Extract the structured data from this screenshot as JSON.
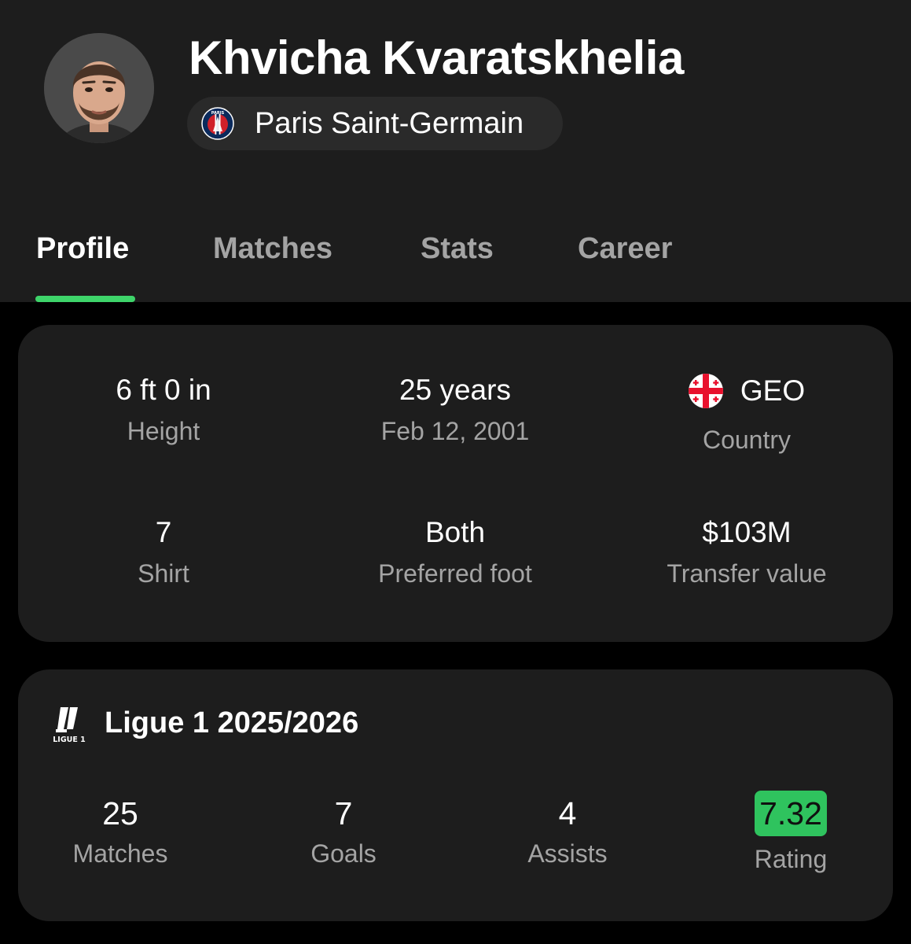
{
  "player": {
    "name": "Khvicha Kvaratskhelia",
    "club": "Paris Saint-Germain",
    "club_logo_text": "PARIS"
  },
  "tabs": [
    {
      "label": "Profile",
      "active": true
    },
    {
      "label": "Matches",
      "active": false
    },
    {
      "label": "Stats",
      "active": false
    },
    {
      "label": "Career",
      "active": false
    }
  ],
  "profile": {
    "height": {
      "value": "6 ft 0 in",
      "label": "Height"
    },
    "age": {
      "value": "25 years",
      "label": "Feb 12, 2001"
    },
    "country": {
      "value": "GEO",
      "label": "Country",
      "flag_icon": "georgia-flag-icon"
    },
    "shirt": {
      "value": "7",
      "label": "Shirt"
    },
    "foot": {
      "value": "Both",
      "label": "Preferred foot"
    },
    "transfer": {
      "value": "$103M",
      "label": "Transfer value"
    }
  },
  "league": {
    "title": "Ligue 1 2025/2026",
    "logo_text": "LIGUE 1",
    "stats": [
      {
        "value": "25",
        "label": "Matches"
      },
      {
        "value": "7",
        "label": "Goals"
      },
      {
        "value": "4",
        "label": "Assists"
      },
      {
        "value": "7.32",
        "label": "Rating"
      }
    ]
  },
  "colors": {
    "accent": "#3ed46a",
    "rating_badge": "#2fc35e",
    "card_bg": "#1d1d1d",
    "muted_text": "#a4a4a4"
  }
}
